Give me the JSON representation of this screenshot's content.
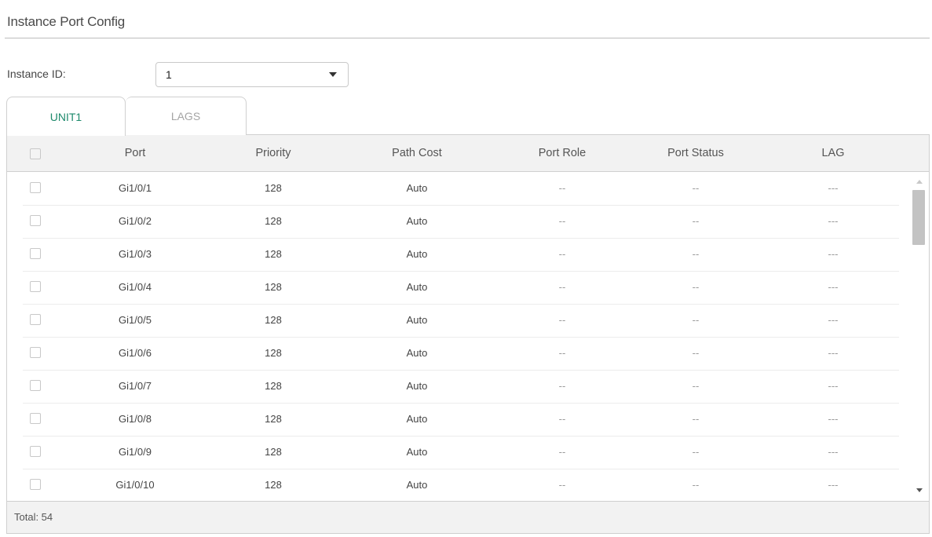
{
  "page": {
    "title": "Instance Port Config"
  },
  "instance": {
    "label": "Instance ID:",
    "value": "1"
  },
  "tabs": [
    {
      "label": "UNIT1",
      "active": true,
      "color": "#1e8a6c"
    },
    {
      "label": "LAGS",
      "active": false
    }
  ],
  "table": {
    "columns": [
      "Port",
      "Priority",
      "Path Cost",
      "Port Role",
      "Port Status",
      "LAG"
    ],
    "rows": [
      {
        "port": "Gi1/0/1",
        "priority": "128",
        "path_cost": "Auto",
        "port_role": "--",
        "port_status": "--",
        "lag": "---"
      },
      {
        "port": "Gi1/0/2",
        "priority": "128",
        "path_cost": "Auto",
        "port_role": "--",
        "port_status": "--",
        "lag": "---"
      },
      {
        "port": "Gi1/0/3",
        "priority": "128",
        "path_cost": "Auto",
        "port_role": "--",
        "port_status": "--",
        "lag": "---"
      },
      {
        "port": "Gi1/0/4",
        "priority": "128",
        "path_cost": "Auto",
        "port_role": "--",
        "port_status": "--",
        "lag": "---"
      },
      {
        "port": "Gi1/0/5",
        "priority": "128",
        "path_cost": "Auto",
        "port_role": "--",
        "port_status": "--",
        "lag": "---"
      },
      {
        "port": "Gi1/0/6",
        "priority": "128",
        "path_cost": "Auto",
        "port_role": "--",
        "port_status": "--",
        "lag": "---"
      },
      {
        "port": "Gi1/0/7",
        "priority": "128",
        "path_cost": "Auto",
        "port_role": "--",
        "port_status": "--",
        "lag": "---"
      },
      {
        "port": "Gi1/0/8",
        "priority": "128",
        "path_cost": "Auto",
        "port_role": "--",
        "port_status": "--",
        "lag": "---"
      },
      {
        "port": "Gi1/0/9",
        "priority": "128",
        "path_cost": "Auto",
        "port_role": "--",
        "port_status": "--",
        "lag": "---"
      },
      {
        "port": "Gi1/0/10",
        "priority": "128",
        "path_cost": "Auto",
        "port_role": "--",
        "port_status": "--",
        "lag": "---"
      }
    ],
    "total_label": "Total: 54"
  },
  "icons": {
    "select_arrow": "chevron-down-icon",
    "scroll_up": "scroll-up-arrow-icon",
    "scroll_down": "scroll-down-arrow-icon"
  }
}
